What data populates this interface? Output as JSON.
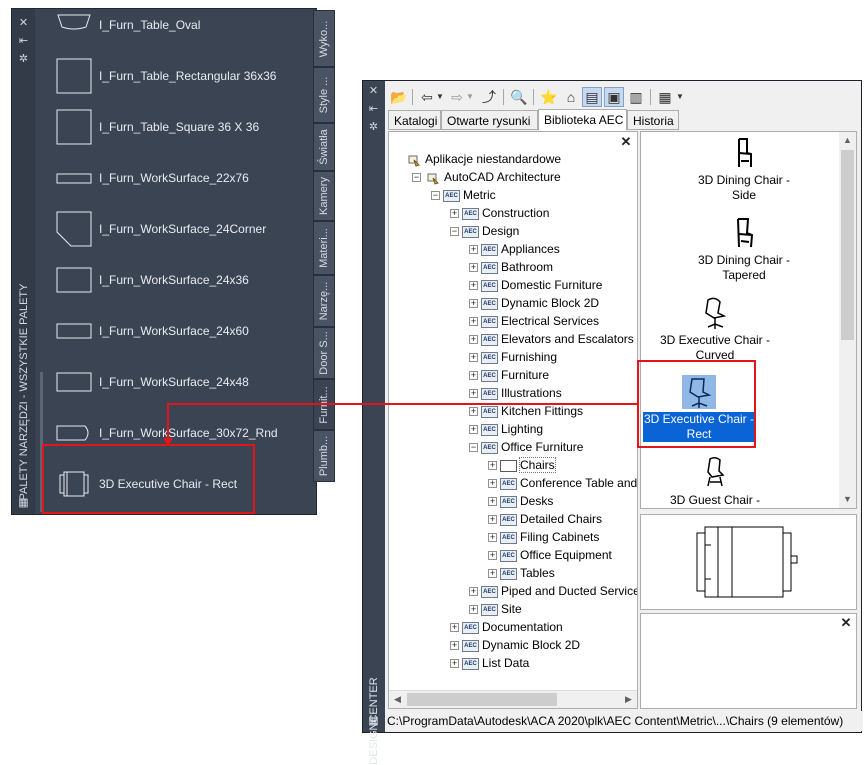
{
  "tool_palette": {
    "title": "PALETY NARZĘDZI - WSZYSTKIE PALETY",
    "tools": [
      {
        "label": "I_Furn_Table_Oval",
        "icon": "table-oval-icon"
      },
      {
        "label": "I_Furn_Table_Rectangular 36x36",
        "icon": "table-rect-icon"
      },
      {
        "label": "I_Furn_Table_Square 36 X 36",
        "icon": "table-square-icon"
      },
      {
        "label": "I_Furn_WorkSurface_22x76",
        "icon": "worksurface-icon"
      },
      {
        "label": "I_Furn_WorkSurface_24Corner",
        "icon": "worksurface-corner-icon"
      },
      {
        "label": "I_Furn_WorkSurface_24x36",
        "icon": "worksurface-icon"
      },
      {
        "label": "I_Furn_WorkSurface_24x60",
        "icon": "worksurface-icon"
      },
      {
        "label": "I_Furn_WorkSurface_24x48",
        "icon": "worksurface-icon"
      },
      {
        "label": "I_Furn_WorkSurface_30x72_Rnd",
        "icon": "worksurface-round-icon"
      },
      {
        "label": "3D Executive Chair - Rect",
        "icon": "chair-icon"
      }
    ],
    "tabs": [
      "Wyko...",
      "Style ...",
      "Światła",
      "Kamery",
      "Materi...",
      "Narzę...",
      "Door S...",
      "Furnit...",
      "Plumb..."
    ],
    "active_tab": "Furnit..."
  },
  "design_center": {
    "title": "DESIGNCENTER",
    "tabs": [
      "Katalogi",
      "Otwarte rysunki",
      "Biblioteka AEC",
      "Historia"
    ],
    "active_tab": "Biblioteka AEC",
    "tree": [
      {
        "label": "Aplikacje niestandardowe",
        "level": 0,
        "expander": "",
        "icon": "apps"
      },
      {
        "label": "AutoCAD Architecture",
        "level": 1,
        "expander": "-",
        "icon": "apps"
      },
      {
        "label": "Metric",
        "level": 2,
        "expander": "-",
        "icon": "aec"
      },
      {
        "label": "Construction",
        "level": 3,
        "expander": "+",
        "icon": "aec"
      },
      {
        "label": "Design",
        "level": 3,
        "expander": "-",
        "icon": "aec"
      },
      {
        "label": "Appliances",
        "level": 4,
        "expander": "+",
        "icon": "aec"
      },
      {
        "label": "Bathroom",
        "level": 4,
        "expander": "+",
        "icon": "aec"
      },
      {
        "label": "Domestic Furniture",
        "level": 4,
        "expander": "+",
        "icon": "aec"
      },
      {
        "label": "Dynamic Block 2D",
        "level": 4,
        "expander": "+",
        "icon": "aec"
      },
      {
        "label": "Electrical Services",
        "level": 4,
        "expander": "+",
        "icon": "aec"
      },
      {
        "label": "Elevators and Escalators",
        "level": 4,
        "expander": "+",
        "icon": "aec"
      },
      {
        "label": "Furnishing",
        "level": 4,
        "expander": "+",
        "icon": "aec"
      },
      {
        "label": "Furniture",
        "level": 4,
        "expander": "+",
        "icon": "aec"
      },
      {
        "label": "Illustrations",
        "level": 4,
        "expander": "+",
        "icon": "aec"
      },
      {
        "label": "Kitchen Fittings",
        "level": 4,
        "expander": "+",
        "icon": "aec"
      },
      {
        "label": "Lighting",
        "level": 4,
        "expander": "+",
        "icon": "aec"
      },
      {
        "label": "Office Furniture",
        "level": 4,
        "expander": "-",
        "icon": "aec"
      },
      {
        "label": "Chairs",
        "level": 5,
        "expander": "+",
        "icon": "folder",
        "selected": true
      },
      {
        "label": "Conference Table and Cl",
        "level": 5,
        "expander": "+",
        "icon": "aec"
      },
      {
        "label": "Desks",
        "level": 5,
        "expander": "+",
        "icon": "aec"
      },
      {
        "label": "Detailed Chairs",
        "level": 5,
        "expander": "+",
        "icon": "aec"
      },
      {
        "label": "Filing Cabinets",
        "level": 5,
        "expander": "+",
        "icon": "aec"
      },
      {
        "label": "Office Equipment",
        "level": 5,
        "expander": "+",
        "icon": "aec"
      },
      {
        "label": "Tables",
        "level": 5,
        "expander": "+",
        "icon": "aec"
      },
      {
        "label": "Piped and Ducted Services",
        "level": 4,
        "expander": "+",
        "icon": "aec"
      },
      {
        "label": "Site",
        "level": 4,
        "expander": "+",
        "icon": "aec"
      },
      {
        "label": "Documentation",
        "level": 3,
        "expander": "+",
        "icon": "aec"
      },
      {
        "label": "Dynamic Block 2D",
        "level": 3,
        "expander": "+",
        "icon": "aec"
      },
      {
        "label": "List Data",
        "level": 3,
        "expander": "+",
        "icon": "aec"
      }
    ],
    "items": [
      {
        "line1": "3D Dining Chair -",
        "line2": "Side",
        "icon": "chair-icon"
      },
      {
        "line1": "3D Dining Chair -",
        "line2": "Tapered",
        "icon": "chair-icon"
      },
      {
        "line1": "3D Executive Chair -",
        "line2": "Curved",
        "icon": "chair-icon"
      },
      {
        "line1": "3D Executive Chair -",
        "line2": "Rect",
        "icon": "chair-icon",
        "selected": true
      },
      {
        "line1": "3D Guest Chair -",
        "line2": "",
        "icon": "chair-icon"
      }
    ],
    "status": "C:\\ProgramData\\Autodesk\\ACA 2020\\plk\\AEC Content\\Metric\\...\\Chairs (9 elementów)"
  },
  "colors": {
    "highlight_red": "#e3141a",
    "selection_blue": "#0a64d6",
    "palette_bg": "#3b4453"
  }
}
